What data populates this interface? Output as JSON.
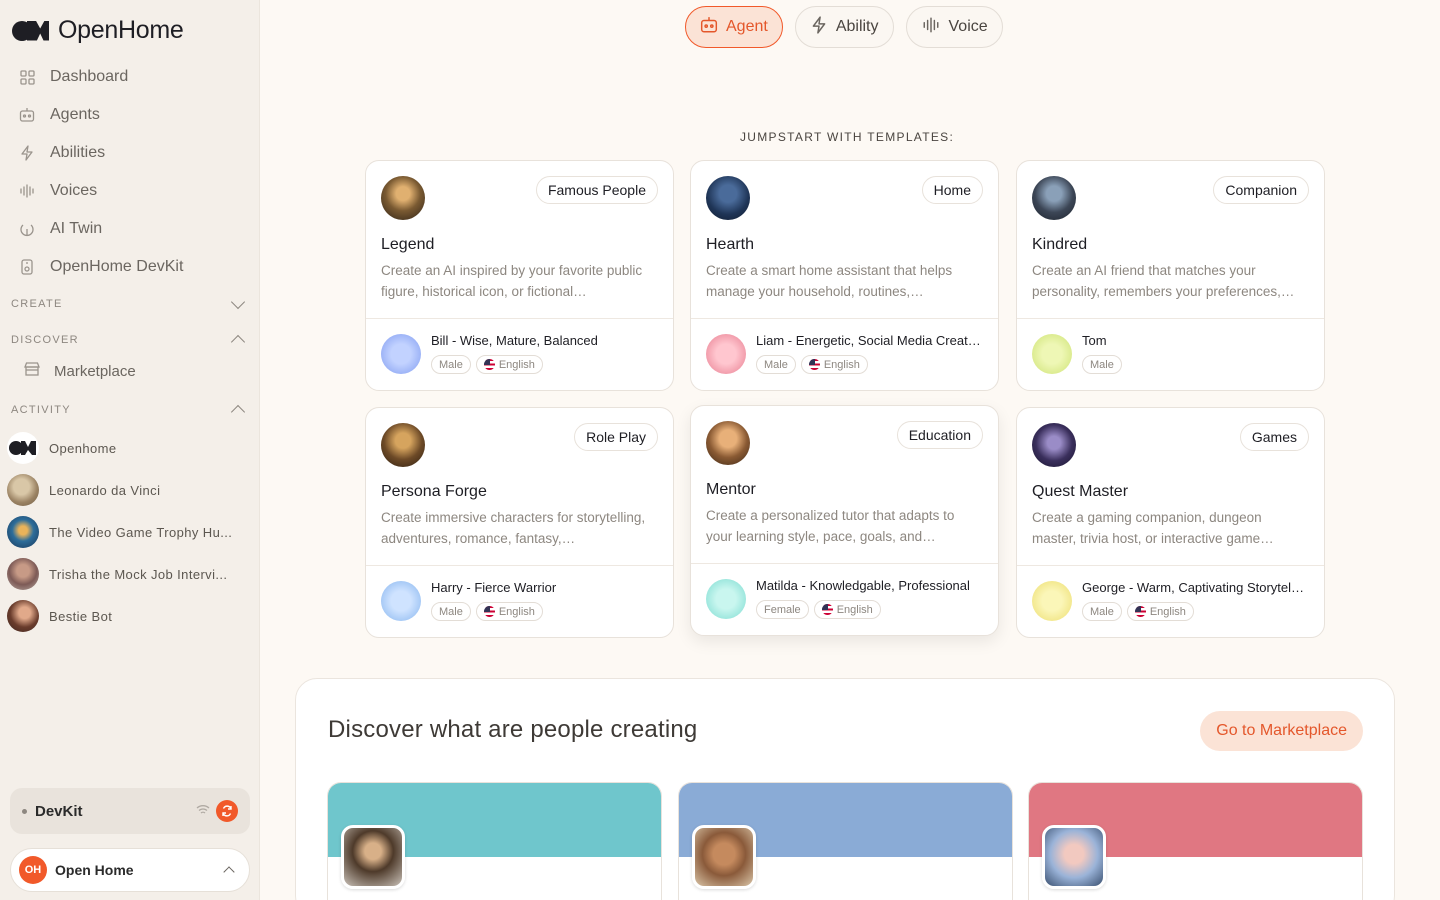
{
  "brand": {
    "name": "OpenHome"
  },
  "sidebar": {
    "nav": [
      {
        "label": "Dashboard",
        "icon": "grid-icon"
      },
      {
        "label": "Agents",
        "icon": "robot-icon"
      },
      {
        "label": "Abilities",
        "icon": "bolt-icon"
      },
      {
        "label": "Voices",
        "icon": "waveform-icon"
      },
      {
        "label": "AI Twin",
        "icon": "fingerprint-icon"
      },
      {
        "label": "OpenHome DevKit",
        "icon": "device-icon"
      }
    ],
    "sections": {
      "create": "CREATE",
      "discover": "DISCOVER",
      "activity": "ACTIVITY"
    },
    "marketplace": "Marketplace",
    "activity": [
      {
        "label": "Openhome"
      },
      {
        "label": "Leonardo da Vinci"
      },
      {
        "label": "The Video Game Trophy Hu..."
      },
      {
        "label": "Trisha the Mock Job Intervi..."
      },
      {
        "label": "Bestie Bot"
      }
    ],
    "devkit": {
      "label": "DevKit"
    },
    "account": {
      "initials": "OH",
      "name": "Open Home"
    }
  },
  "tabs": [
    {
      "label": "Agent",
      "icon": "robot-icon",
      "active": true
    },
    {
      "label": "Ability",
      "icon": "bolt-icon"
    },
    {
      "label": "Voice",
      "icon": "waveform-icon"
    }
  ],
  "templates_heading": "JUMPSTART WITH TEMPLATES:",
  "templates": [
    {
      "tag": "Famous People",
      "title": "Legend",
      "desc": "Create an AI inspired by your favorite public figure, historical icon, or fictional…",
      "voice": "Bill - Wise, Mature, Balanced",
      "chips": [
        "Male",
        "English"
      ]
    },
    {
      "tag": "Home",
      "title": "Hearth",
      "desc": "Create a smart home assistant that helps manage your household, routines,…",
      "voice": "Liam - Energetic, Social Media Creat…",
      "chips": [
        "Male",
        "English"
      ]
    },
    {
      "tag": "Companion",
      "title": "Kindred",
      "desc": "Create an AI friend that matches your personality, remembers your preferences,…",
      "voice": "Tom",
      "chips": [
        "Male"
      ]
    },
    {
      "tag": "Role Play",
      "title": "Persona Forge",
      "desc": "Create immersive characters for storytelling, adventures, romance, fantasy,…",
      "voice": "Harry - Fierce Warrior",
      "chips": [
        "Male",
        "English"
      ]
    },
    {
      "tag": "Education",
      "title": "Mentor",
      "desc": "Create a personalized tutor that adapts to your learning style, pace, goals, and…",
      "voice": "Matilda - Knowledgable, Professional",
      "chips": [
        "Female",
        "English"
      ]
    },
    {
      "tag": "Games",
      "title": "Quest Master",
      "desc": "Create a gaming companion, dungeon master, trivia host, or interactive game…",
      "voice": "George - Warm, Captivating Storytel…",
      "chips": [
        "Male",
        "English"
      ]
    }
  ],
  "discover": {
    "title": "Discover what are people creating",
    "button": "Go to Marketplace"
  },
  "colors": {
    "accent": "#f1592a",
    "banner_teal": "#6fc6cc",
    "banner_blue": "#8aabd6",
    "banner_rose": "#e07782"
  }
}
